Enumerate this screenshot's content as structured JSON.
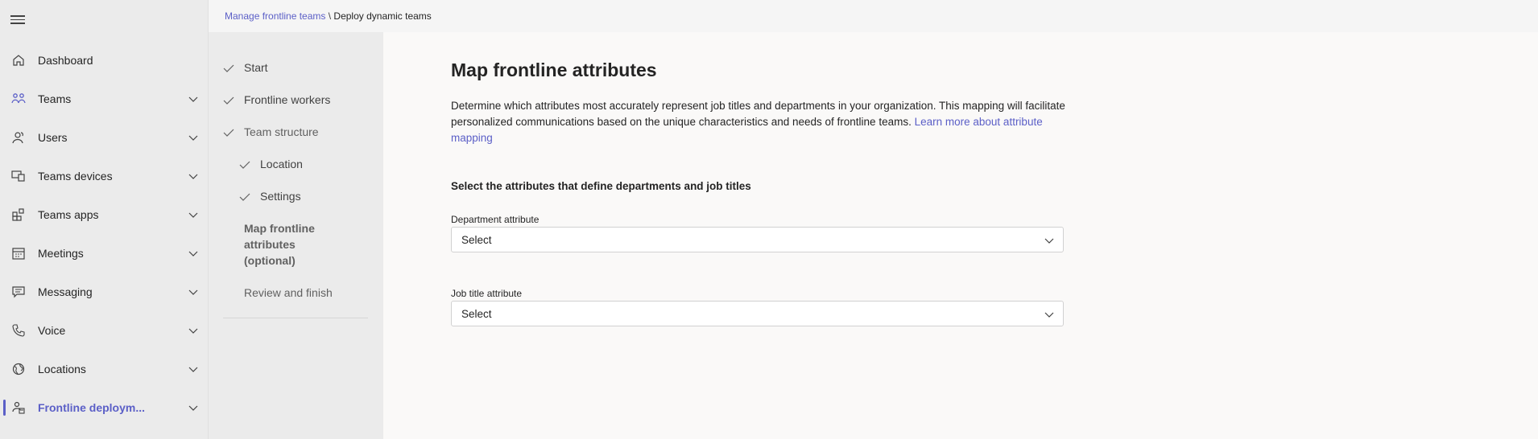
{
  "breadcrumb": {
    "parent": "Manage frontline teams",
    "separator": " \\ ",
    "current": "Deploy dynamic teams"
  },
  "nav": {
    "items": [
      {
        "label": "Dashboard",
        "icon": "home-icon",
        "expandable": false
      },
      {
        "label": "Teams",
        "icon": "teams-icon",
        "expandable": true
      },
      {
        "label": "Users",
        "icon": "users-icon",
        "expandable": true
      },
      {
        "label": "Teams devices",
        "icon": "devices-icon",
        "expandable": true
      },
      {
        "label": "Teams apps",
        "icon": "apps-icon",
        "expandable": true
      },
      {
        "label": "Meetings",
        "icon": "calendar-icon",
        "expandable": true
      },
      {
        "label": "Messaging",
        "icon": "chat-icon",
        "expandable": true
      },
      {
        "label": "Voice",
        "icon": "phone-icon",
        "expandable": true
      },
      {
        "label": "Locations",
        "icon": "globe-icon",
        "expandable": true
      },
      {
        "label": "Frontline deploym...",
        "icon": "frontline-icon",
        "expandable": true,
        "active": true
      }
    ]
  },
  "steps": [
    {
      "label": "Start",
      "status": "done"
    },
    {
      "label": "Frontline workers",
      "status": "done"
    },
    {
      "label": "Team structure",
      "status": "done"
    },
    {
      "label": "Location",
      "status": "done"
    },
    {
      "label": "Settings",
      "status": "done"
    },
    {
      "label_lines": [
        "Map frontline",
        "attributes",
        "(optional)"
      ],
      "status": "current"
    },
    {
      "label": "Review and finish",
      "status": "pending"
    }
  ],
  "main": {
    "title": "Map frontline attributes",
    "description": "Determine which attributes most accurately represent job titles and departments in your organization. This mapping will facilitate personalized communications based on the unique characteristics and needs of frontline teams.",
    "learn_more": "Learn more about attribute mapping",
    "section_title": "Select the attributes that define departments and job titles",
    "department_label": "Department attribute",
    "department_value": "Select",
    "job_title_label": "Job title attribute",
    "job_title_value": "Select"
  },
  "colors": {
    "accent": "#5b5fc7",
    "nav_bg": "#ebebeb",
    "page_bg": "#faf9f8"
  }
}
